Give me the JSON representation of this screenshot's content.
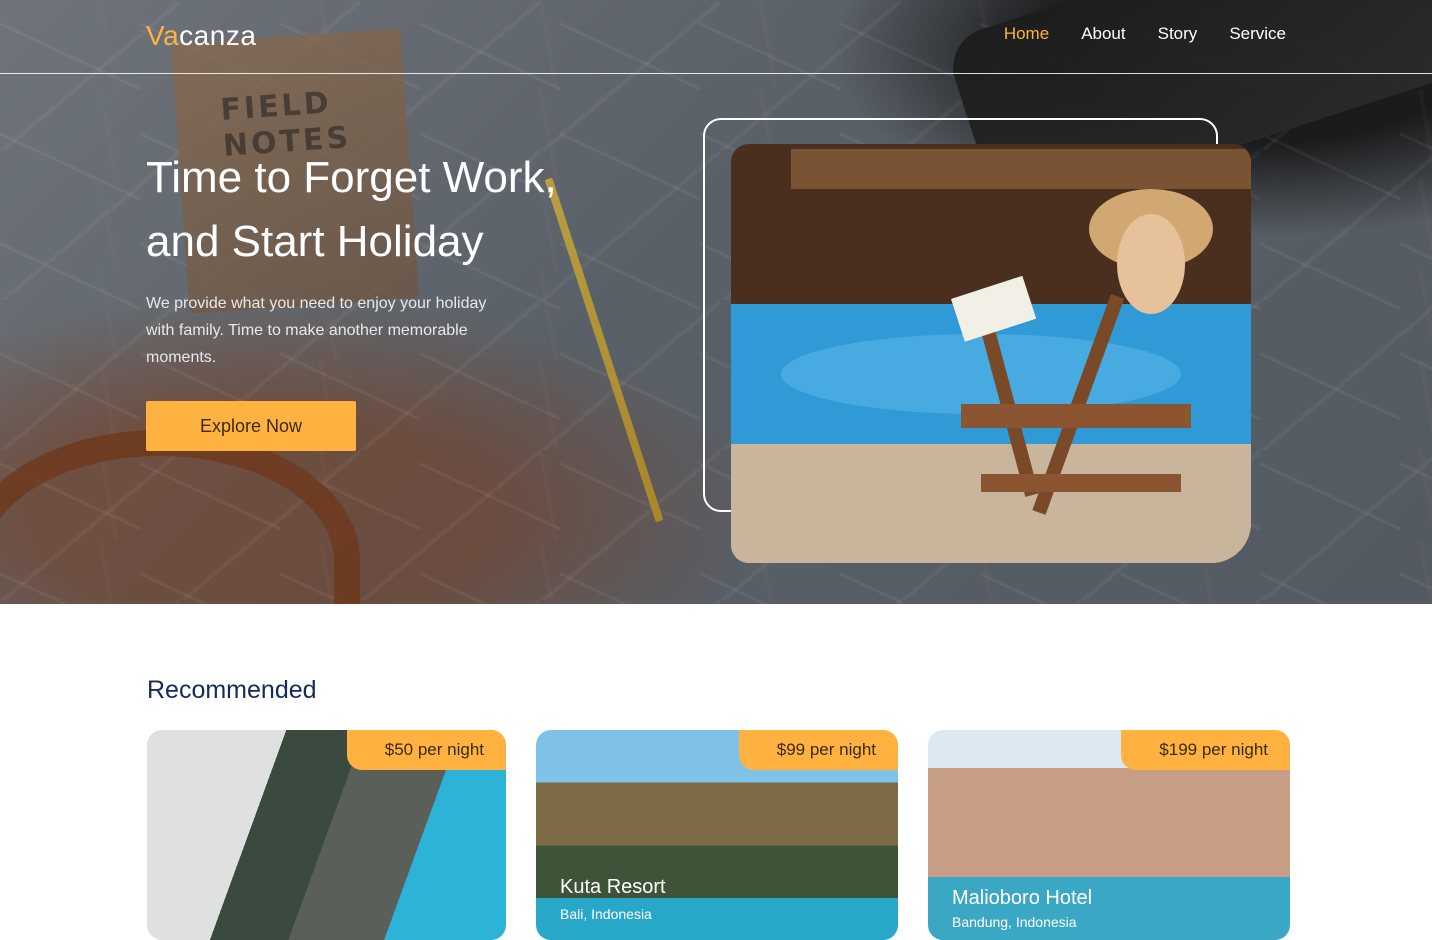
{
  "brand": {
    "accent": "Va",
    "rest": "canza"
  },
  "nav": {
    "items": [
      {
        "label": "Home",
        "active": true
      },
      {
        "label": "About",
        "active": false
      },
      {
        "label": "Story",
        "active": false
      },
      {
        "label": "Service",
        "active": false
      }
    ]
  },
  "hero": {
    "title_line1": "Time to Forget Work,",
    "title_line2": "and Start Holiday",
    "description": "We provide what you need to enjoy your holiday with family.  Time to make another memorable moments.",
    "cta_label": "Explore Now",
    "notebook_text": "FIELD NOTES"
  },
  "recommended": {
    "heading": "Recommended",
    "cards": [
      {
        "price": "$50 per night",
        "name": "",
        "location": ""
      },
      {
        "price": "$99 per night",
        "name": "Kuta Resort",
        "location": "Bali, Indonesia"
      },
      {
        "price": "$199 per night",
        "name": "Malioboro Hotel",
        "location": "Bandung, Indonesia"
      }
    ]
  },
  "colors": {
    "accent": "#ffb23f",
    "heading": "#152c5b"
  }
}
